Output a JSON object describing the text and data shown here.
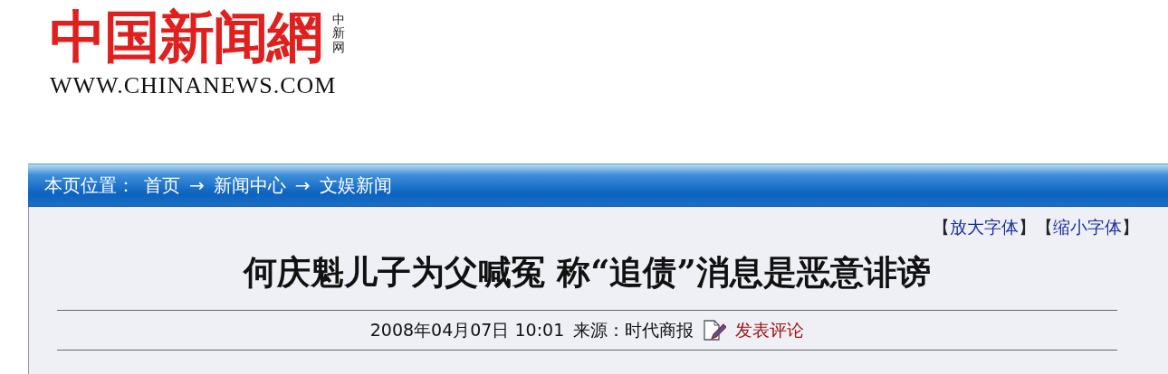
{
  "logo": {
    "title": "中国新闻網",
    "badge": "中新网",
    "url": "WWW.CHINANEWS.COM"
  },
  "breadcrumb": {
    "label": "本页位置：",
    "links": [
      "首页",
      "新闻中心",
      "文娱新闻"
    ],
    "separators": [
      "→",
      "→"
    ]
  },
  "font_controls": [
    {
      "open": "【",
      "text": "放大字体",
      "close": "】"
    },
    {
      "open": "【",
      "text": "缩小字体",
      "close": "】"
    }
  ],
  "article": {
    "title": "何庆魁儿子为父喊冤 称“追债”消息是恶意诽谤",
    "date": "2008年04月07日 10:01",
    "source": "来源：时代商报",
    "comment_link": "发表评论"
  }
}
